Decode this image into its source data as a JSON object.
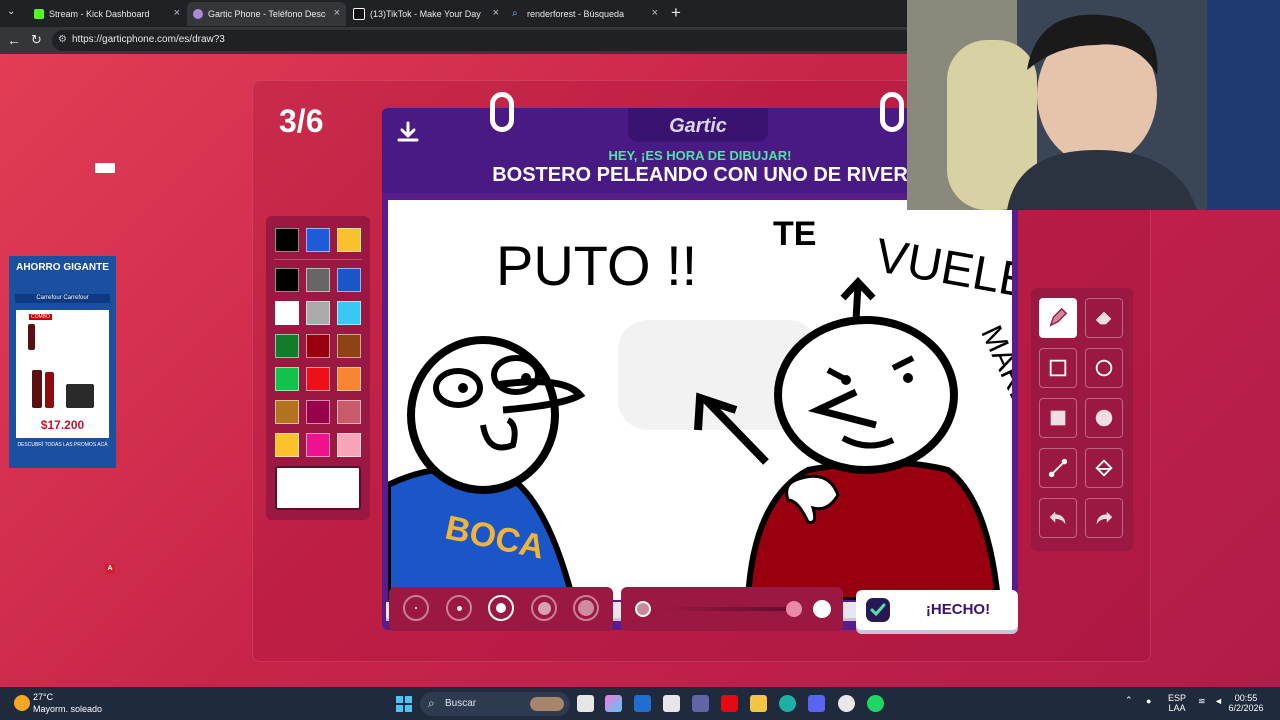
{
  "browser": {
    "tabs": [
      {
        "title": "Stream - Kick Dashboard",
        "color": "#53fc18"
      },
      {
        "title": "Gartic Phone - Teléfono Descomp",
        "color": "#a98bd8"
      },
      {
        "title": "(13)TikTok - Make Your Day",
        "color": "#ffffff"
      },
      {
        "title": "renderforest - Búsqueda",
        "color": "#3b82f6"
      }
    ],
    "url": "https://garticphone.com/es/draw?3"
  },
  "game": {
    "round": "3/6",
    "logo": "Gartic",
    "hey_text": "HEY, ¡ES HORA DE DIBUJAR!",
    "prompt": "BOSTERO PELEANDO CON UNO DE RIVER",
    "done_label": "¡HECHO!",
    "selected_tool": "pencil",
    "selected_brush_size": 3,
    "primary_colors": [
      "#000000",
      "#1f5bd6",
      "#fbc02d"
    ],
    "palette": [
      "#000000",
      "#666666",
      "#1a56c8",
      "#ffffff",
      "#aaaaaa",
      "#38c8f4",
      "#107c2c",
      "#99000f",
      "#8f4213",
      "#13c24b",
      "#ee0f18",
      "#f78531",
      "#b1731d",
      "#99004b",
      "#c85a6a",
      "#fcc22a",
      "#f0118f",
      "#f7a5b6"
    ],
    "tools": [
      "pencil",
      "eraser",
      "rectangle",
      "ellipse",
      "filled-rectangle",
      "filled-ellipse",
      "line",
      "fill-bucket",
      "undo",
      "redo"
    ],
    "drawing_texts": {
      "top_left": "PUTO !!",
      "top_right_1": "TE",
      "top_right_2": "VUELE",
      "side": "MARDO",
      "shirt": "BOCA"
    }
  },
  "ad": {
    "headline": "AHORRO GIGANTE",
    "brand": "Carrefour  Carrefour",
    "combo": "COMBO",
    "price": "$17.200",
    "footer": "DESCUBRÍ TODAS LAS PROMOS ACÁ"
  },
  "taskbar": {
    "temperature": "27°C",
    "weather": "Mayorm. soleado",
    "search_placeholder": "Buscar",
    "lang1": "ESP",
    "lang2": "LAA",
    "time": "00:55",
    "date": "6/2/2026"
  }
}
